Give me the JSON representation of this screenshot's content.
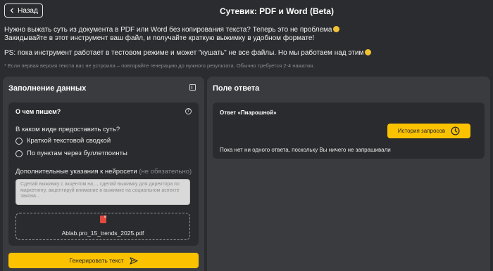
{
  "header": {
    "back_label": "Назад",
    "title": "Сутевик: PDF и Word (Beta)"
  },
  "intro": {
    "line1": "Нужно выжать суть из документа в PDF или Word без копирования текста? Теперь это не проблема",
    "line2": "Закидывайте в этот инструмент ваш файл, и получайте краткую выжимку в удобном формате!",
    "line3": "PS: пока инструмент работает в тестовом режиме и может \"кушать\" не все файлы. Но мы работаем над этим",
    "hint": "* Если первая версия текста вас не устроила – повторяйте генерацию до нужного результата. Обычно требуется 2-4 нажатия."
  },
  "left_panel": {
    "title": "Заполнение данных",
    "card_title": "О чем пишем?",
    "question": "В каком виде предоставить суть?",
    "options": [
      "Краткой текстовой сводкой",
      "По пунктам через буллетпоинты"
    ],
    "extra_label": "Дополнительные указания к нейросети",
    "extra_optional": "(не обязательно)",
    "textarea_placeholder": "Сделай выжимку с акцентом на..., сделай выжимку для директора по маркетингу, акцентируй внимание в выжимке на социальном аспекте закона...",
    "file_name": "Ablab.pro_15_trends_2025.pdf",
    "generate_label": "Генерировать текст"
  },
  "right_panel": {
    "title": "Поле ответа",
    "answer_title": "Ответ «Пиарошной»",
    "history_label": "История запросов",
    "empty_text": "Пока нет ни одного ответа, поскольку Вы ничего не запрашивали"
  },
  "colors": {
    "background": "#2b2c2f",
    "panel": "#3a3b3f",
    "card": "#2a2b2e",
    "accent": "#fbc200"
  }
}
